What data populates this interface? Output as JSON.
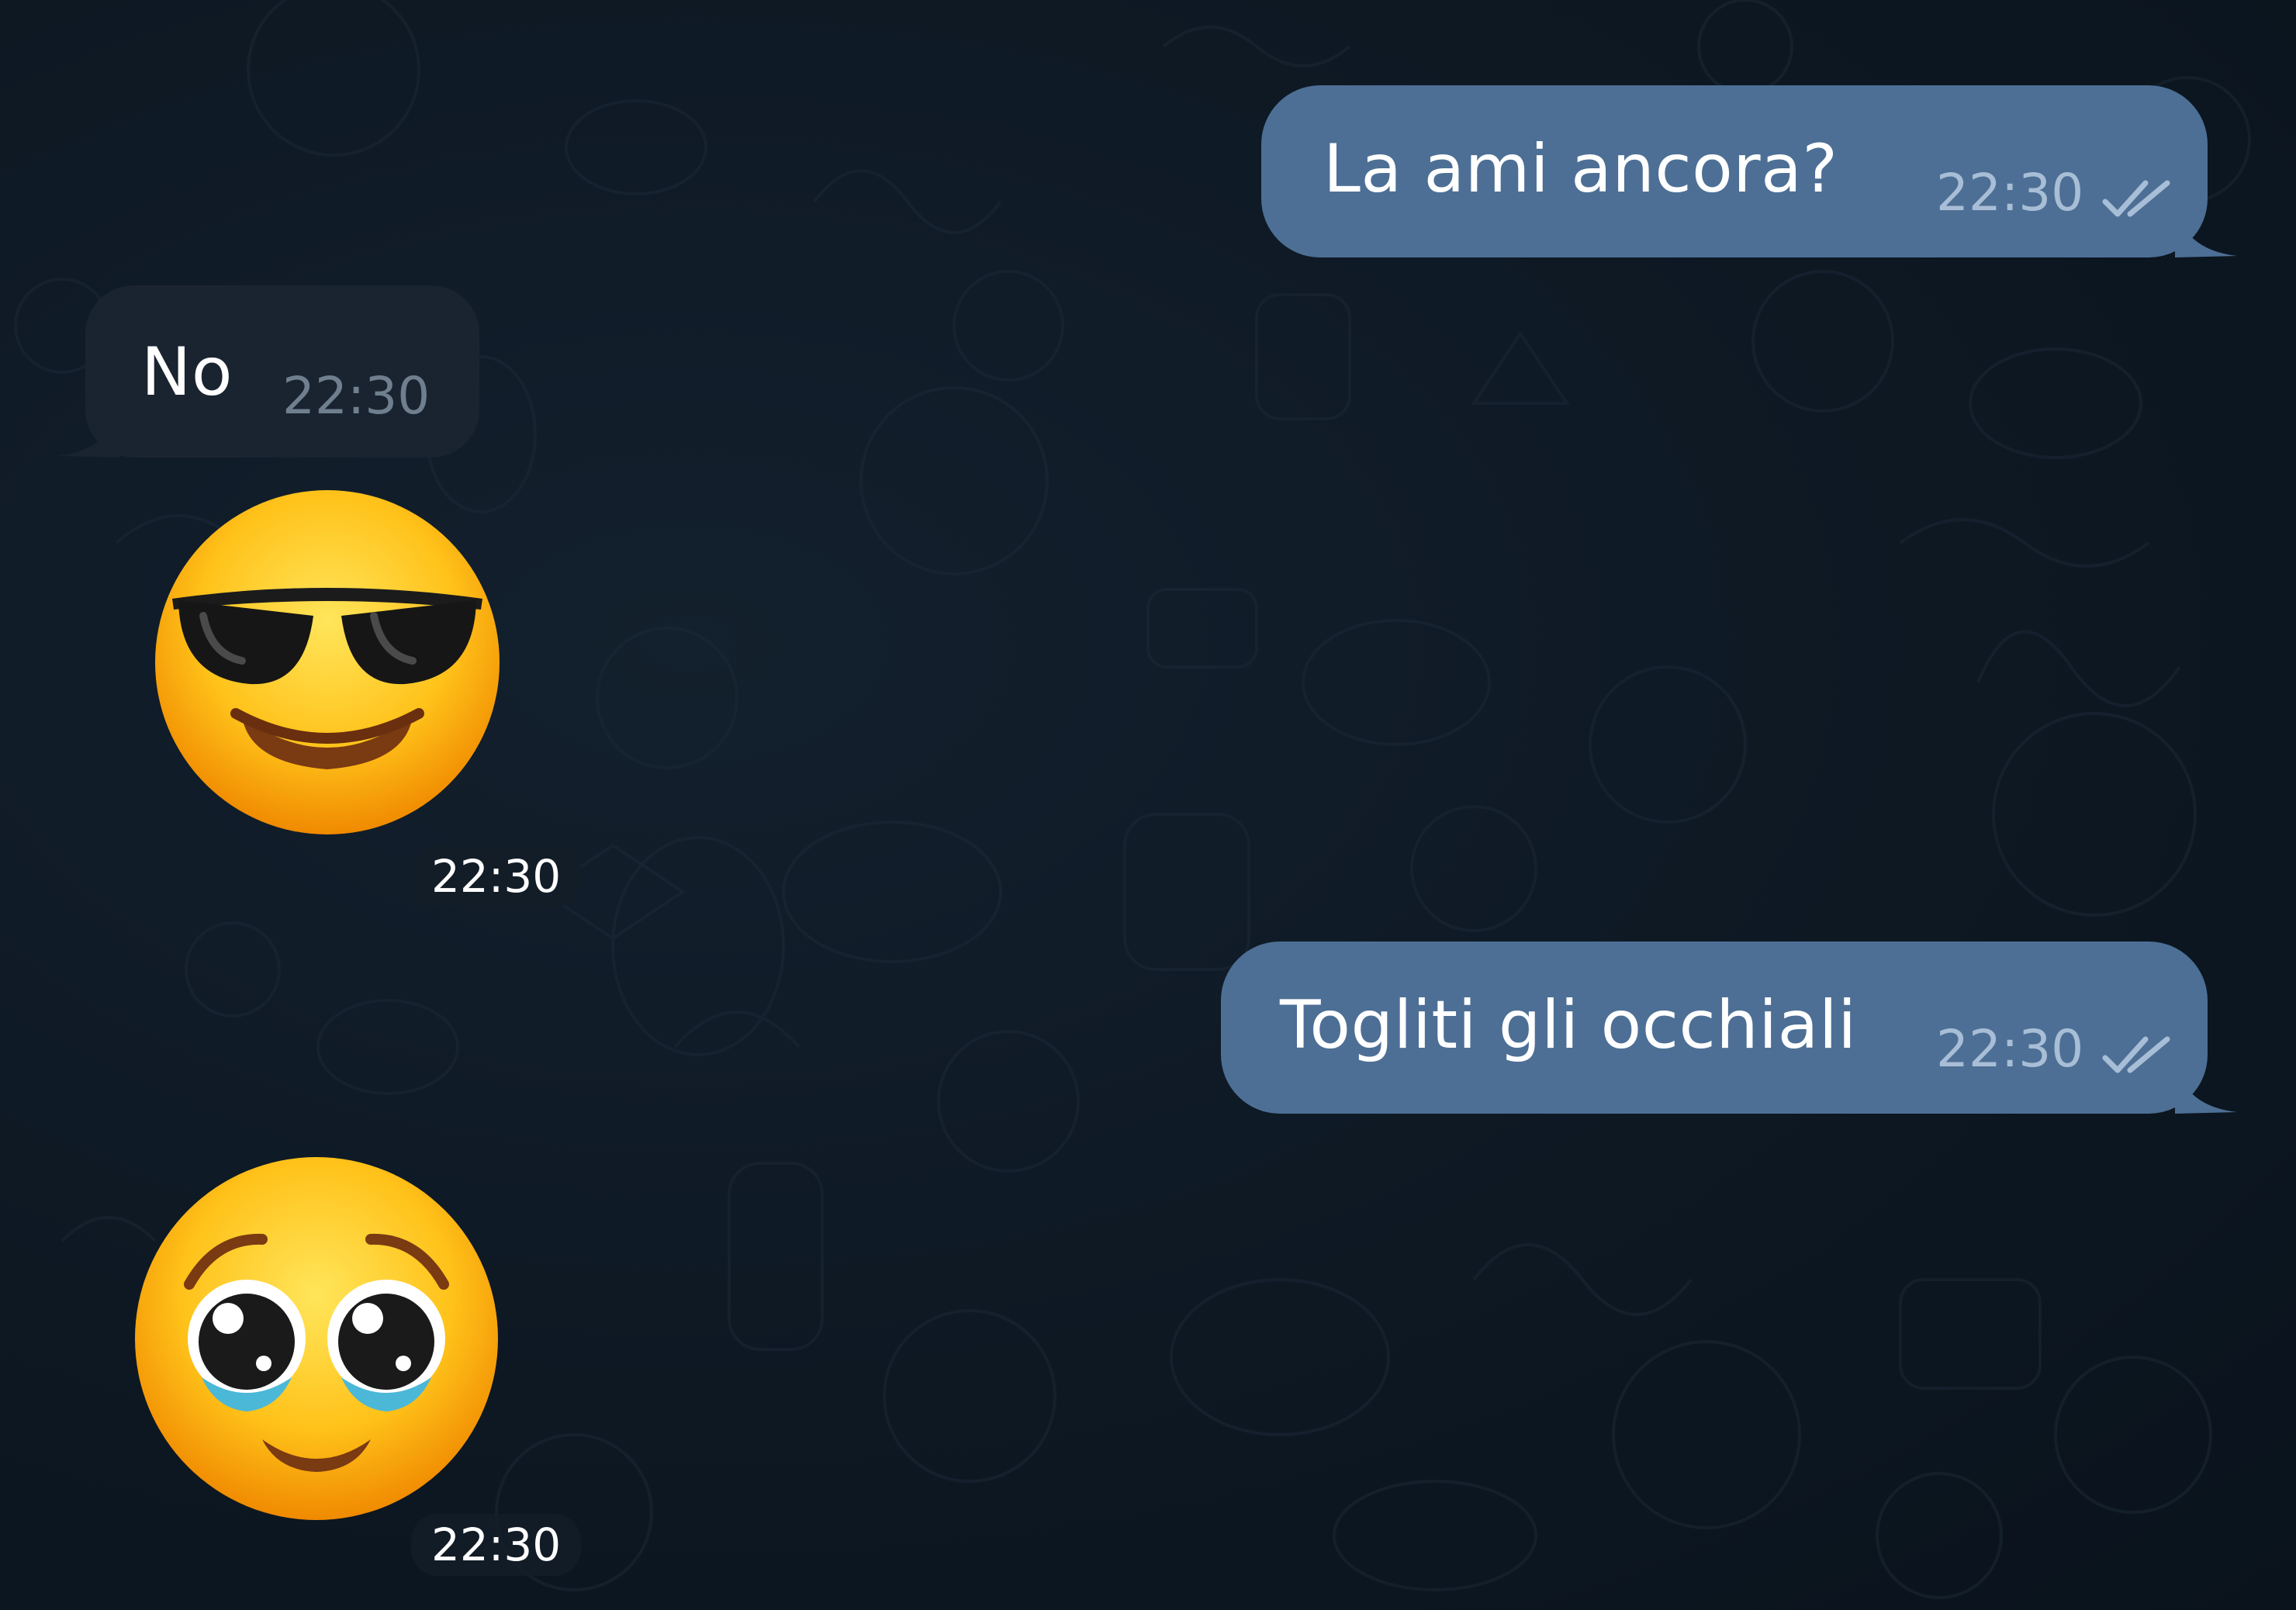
{
  "messages": [
    {
      "direction": "outgoing",
      "text": "La ami ancora?",
      "time": "22:30",
      "status": "read-double-check-icon"
    },
    {
      "direction": "incoming",
      "text": "No",
      "time": "22:30"
    },
    {
      "direction": "incoming",
      "type": "sticker",
      "emoji": "smiling-face-with-sunglasses-icon",
      "time": "22:30"
    },
    {
      "direction": "outgoing",
      "text": "Togliti gli occhiali",
      "time": "22:30",
      "status": "read-double-check-icon"
    },
    {
      "direction": "incoming",
      "type": "sticker",
      "emoji": "pleading-face-icon",
      "time": "22:30"
    }
  ],
  "colors": {
    "background": "#0c1621",
    "outgoing_bubble": "#4d6f95",
    "incoming_bubble": "#1a2430",
    "outgoing_time": "#a8bed6",
    "incoming_time": "#6f7f8e"
  }
}
